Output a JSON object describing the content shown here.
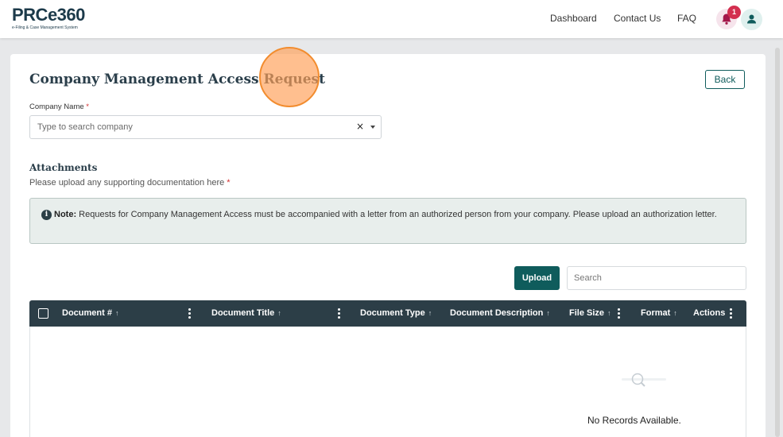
{
  "header": {
    "logo_text": "PRCe360",
    "logo_sub": "e-Filing & Case Management System",
    "nav": [
      "Dashboard",
      "Contact Us",
      "FAQ"
    ],
    "notification_count": "1"
  },
  "page": {
    "title": "Company Management Access Request",
    "back_label": "Back",
    "company_label": "Company Name",
    "required_mark": "*",
    "company_placeholder": "Type to search company",
    "clear_glyph": "×"
  },
  "attachments": {
    "title": "Attachments",
    "help": "Please upload any supporting documentation here",
    "note_label": "Note:",
    "note_text": " Requests for Company Management Access must be accompanied with a letter from an authorized person from your company. Please upload an authorization letter.",
    "upload_label": "Upload",
    "search_placeholder": "Search"
  },
  "table": {
    "columns": [
      "Document #",
      "Document Title",
      "Document Type",
      "Document Description",
      "File Size",
      "Format",
      "Actions"
    ],
    "sort_glyph": "↑",
    "empty_text": "No Records Available."
  },
  "colors": {
    "primary": "#0f5c5c",
    "table_header": "#2c3e47",
    "required": "#d32f2f",
    "badge": "#d32f4f"
  },
  "icons": [
    "bell-icon",
    "user-icon",
    "info-icon",
    "search-magnifier-icon",
    "kebab-menu-icon",
    "sort-arrow-icon"
  ]
}
